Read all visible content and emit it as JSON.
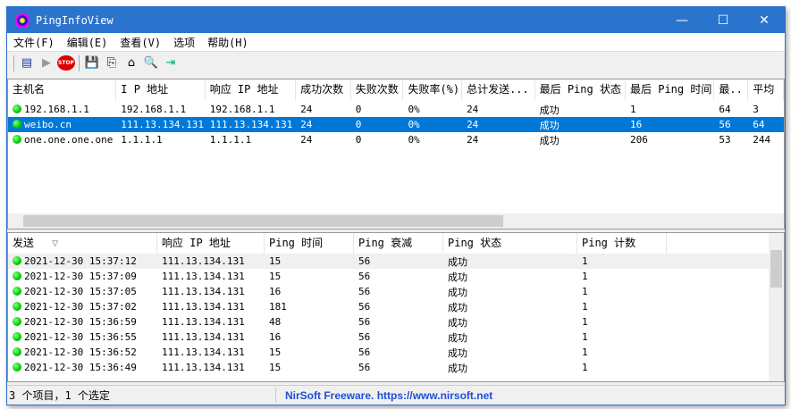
{
  "window": {
    "title": "PingInfoView",
    "minimize": "—",
    "maximize": "☐",
    "close": "✕"
  },
  "menu": [
    "文件(F)",
    "编辑(E)",
    "查看(V)",
    "选项",
    "帮助(H)"
  ],
  "toolbar": {
    "properties": "▤",
    "start": "▶",
    "stop": "STOP",
    "save": "💾",
    "copy": "⎘",
    "html": "⌂",
    "find": "🔍",
    "exit": "⇥"
  },
  "hosts": {
    "columns": [
      "主机名",
      "I P 地址",
      "响应 IP 地址",
      "成功次数",
      "失败次数",
      "失败率(%)",
      "总计发送...",
      "最后 Ping 状态",
      "最后 Ping 时间",
      "最..",
      "平均"
    ],
    "rows": [
      [
        "192.168.1.1",
        "192.168.1.1",
        "192.168.1.1",
        "24",
        "0",
        "0%",
        "24",
        "成功",
        "1",
        "64",
        "3"
      ],
      [
        "weibo.cn",
        "111.13.134.131",
        "111.13.134.131",
        "24",
        "0",
        "0%",
        "24",
        "成功",
        "16",
        "56",
        "64"
      ],
      [
        "one.one.one.one",
        "1.1.1.1",
        "1.1.1.1",
        "24",
        "0",
        "0%",
        "24",
        "成功",
        "206",
        "53",
        "244"
      ]
    ],
    "selected": 1
  },
  "history": {
    "columns": [
      "发送",
      "响应 IP 地址",
      "Ping 时间",
      "Ping 衰减",
      "Ping 状态",
      "Ping 计数"
    ],
    "sort_icon": "▽",
    "rows": [
      [
        "2021-12-30 15:37:12",
        "111.13.134.131",
        "15",
        "56",
        "成功",
        "1"
      ],
      [
        "2021-12-30 15:37:09",
        "111.13.134.131",
        "15",
        "56",
        "成功",
        "1"
      ],
      [
        "2021-12-30 15:37:05",
        "111.13.134.131",
        "16",
        "56",
        "成功",
        "1"
      ],
      [
        "2021-12-30 15:37:02",
        "111.13.134.131",
        "181",
        "56",
        "成功",
        "1"
      ],
      [
        "2021-12-30 15:36:59",
        "111.13.134.131",
        "48",
        "56",
        "成功",
        "1"
      ],
      [
        "2021-12-30 15:36:55",
        "111.13.134.131",
        "16",
        "56",
        "成功",
        "1"
      ],
      [
        "2021-12-30 15:36:52",
        "111.13.134.131",
        "15",
        "56",
        "成功",
        "1"
      ],
      [
        "2021-12-30 15:36:49",
        "111.13.134.131",
        "15",
        "56",
        "成功",
        "1"
      ]
    ]
  },
  "status": {
    "count": "3 个项目，1 个选定",
    "link": "NirSoft Freeware. https://www.nirsoft.net"
  }
}
